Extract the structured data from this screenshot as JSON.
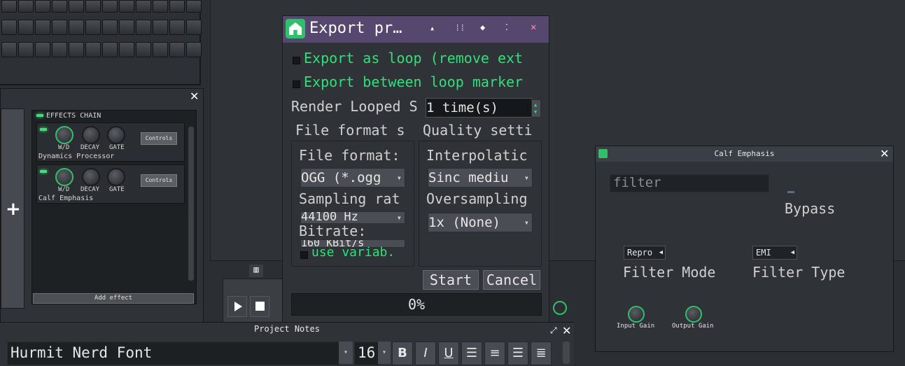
{
  "effects_window": {
    "chain_label": "EFFECTS CHAIN",
    "plugins": [
      {
        "name": "Dynamics Processor",
        "knob_labels": [
          "W/D",
          "DECAY",
          "GATE"
        ],
        "controls_label": "Controls"
      },
      {
        "name": "Calf Emphasis",
        "knob_labels": [
          "W/D",
          "DECAY",
          "GATE"
        ],
        "controls_label": "Controls"
      }
    ],
    "add_effect_label": "Add effect",
    "plus_icon": "+",
    "close_icon": "✕"
  },
  "export_dialog": {
    "title": "Export pr…",
    "title_icons": [
      "minimize-icon",
      "maximize-icon",
      "shade-icon",
      "restore-icon",
      "close-icon"
    ],
    "export_loop_label": "Export as loop (remove ext",
    "export_between_label": "Export between loop marker",
    "render_looped_label": "Render Looped S",
    "render_looped_value": "1 time(s)",
    "file_format_group_label": "File format s",
    "quality_group_label": "Quality setti",
    "file_format_label": "File format:",
    "file_format_value": "OGG (*.ogg",
    "sampling_rate_label": "Sampling rat",
    "sampling_rate_value": "44100 Hz",
    "bitrate_label": "Bitrate:",
    "bitrate_value": "160 KBit/s",
    "use_variable_label": "use variab.",
    "interpolation_label": "Interpolatic",
    "interpolation_value": "Sinc mediu",
    "oversampling_label": "Oversampling",
    "oversampling_value": "1x (None)",
    "start_label": "Start",
    "cancel_label": "Cancel",
    "progress_text": "0%",
    "progress_value": 0
  },
  "calf_window": {
    "title": "Calf Emphasis",
    "filter_placeholder": "filter",
    "bypass_label": "Bypass",
    "filter_mode_value": "Repro",
    "filter_mode_label": "Filter Mode",
    "filter_type_value": "EMI",
    "filter_type_label": "Filter Type",
    "input_gain_label": "Input Gain",
    "output_gain_label": "Output Gain",
    "close_icon": "✕"
  },
  "project_notes": {
    "title": "Project Notes",
    "font_value": "Hurmit Nerd Font",
    "size_value": "16",
    "format_buttons": [
      "B",
      "I",
      "U"
    ],
    "align_icons": [
      "align-left-icon",
      "align-center-icon",
      "align-right-icon",
      "align-justify-icon"
    ]
  },
  "colors": {
    "accent_green": "#2ee07a",
    "title_purple": "#55476e",
    "window_bg": "#2f3338"
  }
}
